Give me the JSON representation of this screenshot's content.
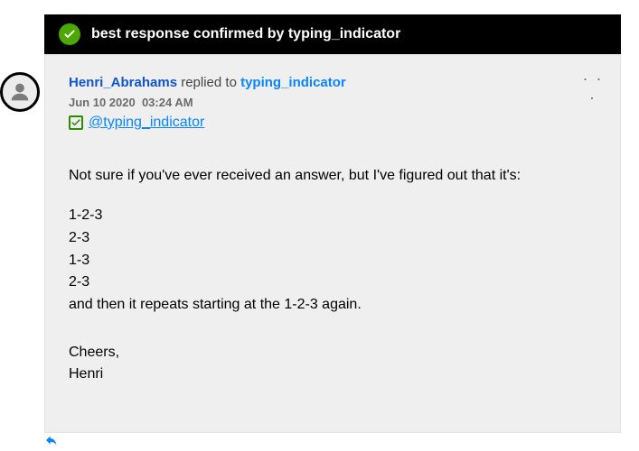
{
  "banner": {
    "label": "best response confirmed by typing_indicator"
  },
  "post": {
    "author": "Henri_Abrahams",
    "replied_label": " replied to ",
    "recipient": "typing_indicator",
    "date": "Jun 10 2020",
    "time": "03:24 AM",
    "mention": "@typing_indicator",
    "body_intro": "Not sure if you've ever received an answer, but I've figured out that it's:",
    "sequence": [
      "1-2-3",
      "2-3",
      "1-3",
      "2-3"
    ],
    "body_repeat": "and then it repeats starting at the 1-2-3 again.",
    "sign_cheers": "Cheers,",
    "sign_name": "Henri"
  },
  "actions": {
    "more": "· · ·"
  }
}
